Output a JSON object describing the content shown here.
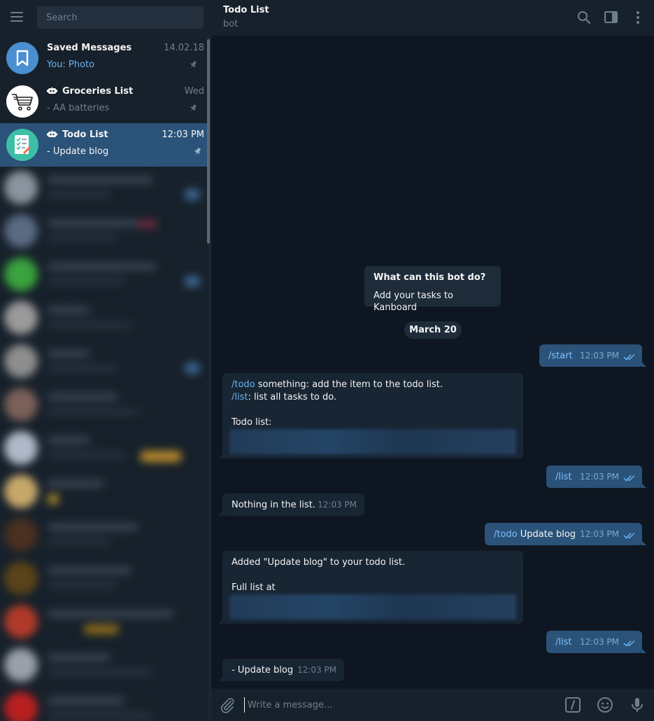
{
  "sidebar": {
    "search_placeholder": "Search",
    "chats": [
      {
        "name": "Saved Messages",
        "time": "14.02.18",
        "preview": "You: Photo",
        "is_bot": false,
        "pinned": true
      },
      {
        "name": "Groceries List",
        "time": "Wed",
        "preview": "- AA batteries",
        "is_bot": true,
        "pinned": true
      },
      {
        "name": "Todo List",
        "time": "12:03 PM",
        "preview": "- Update blog",
        "is_bot": true,
        "pinned": true,
        "active": true
      }
    ]
  },
  "header": {
    "title": "Todo List",
    "status": "bot",
    "icons": [
      "search-icon",
      "sidebar-toggle-icon",
      "more-icon"
    ]
  },
  "chat": {
    "bot_info": {
      "title": "What can this bot do?",
      "description": "Add your tasks to Kanboard"
    },
    "date": "March 20",
    "messages": {
      "m1": {
        "cmd": "/start",
        "time": "12:03 PM"
      },
      "m2": {
        "line1_cmd": "/todo",
        "line1_rest": " something: add the item to the todo list.",
        "line2_cmd": "/list",
        "line2_rest": ": list all tasks to do.",
        "line3": "Todo list:"
      },
      "m3": {
        "cmd": "/list",
        "time": "12:03 PM"
      },
      "m4": {
        "text": "Nothing in the list.",
        "time": "12:03 PM"
      },
      "m5": {
        "cmd": "/todo",
        "rest": " Update blog",
        "time": "12:03 PM"
      },
      "m6": {
        "line1": "Added \"Update blog\" to your todo list.",
        "line2": "Full list at"
      },
      "m7": {
        "cmd": "/list",
        "time": "12:03 PM"
      },
      "m8": {
        "text": "- Update blog",
        "time": "12:03 PM"
      }
    }
  },
  "composer": {
    "placeholder": "Write a message...",
    "icons": [
      "attach-icon",
      "commands-icon",
      "emoji-icon",
      "mic-icon"
    ]
  },
  "colors": {
    "sidebar_bg": "#17212b",
    "chat_bg": "#0e1621",
    "active_chat": "#2b5278",
    "incoming_bubble": "#182533",
    "outgoing_bubble": "#2b5278",
    "link": "#6ab3f3",
    "muted": "#6d7f8f"
  }
}
